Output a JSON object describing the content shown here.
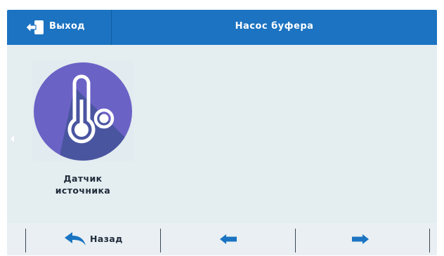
{
  "header": {
    "exit_label": "Выход",
    "title": "Насос буфера"
  },
  "tiles": [
    {
      "label_line1": "Датчик",
      "label_line2": "источника",
      "icon": "thermometer-icon"
    }
  ],
  "footer": {
    "back_label": "Назад",
    "back_icon": "back-arrow-icon",
    "prev_icon": "arrow-left-icon",
    "next_icon": "arrow-right-icon"
  },
  "colors": {
    "header_bg": "#1b73c1",
    "screen_bg": "#e4edf0",
    "icon_circle": "#6b62c6",
    "icon_shadow": "#4a55a0",
    "arrow_blue": "#1a74c2",
    "text_dark": "#1f2b3a"
  }
}
